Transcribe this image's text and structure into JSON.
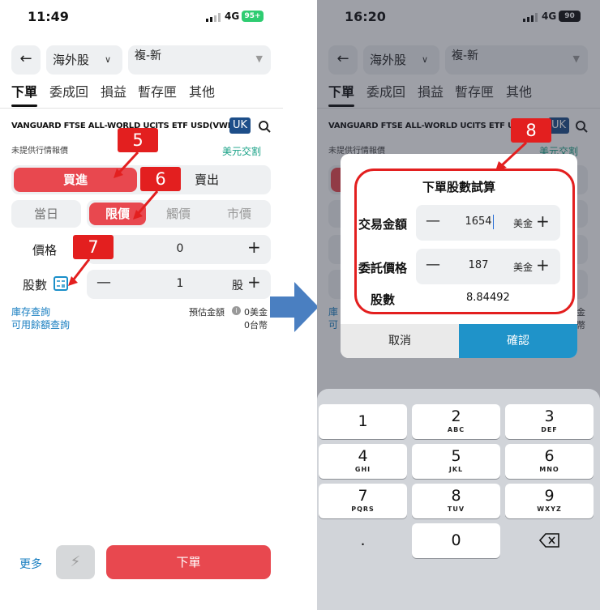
{
  "left": {
    "status": {
      "time": "11:49",
      "network": "4G",
      "battery": "95+"
    },
    "market_select": "海外股",
    "stock_select": "複-新",
    "tabs": [
      "下單",
      "委成回",
      "損益",
      "暫存匣",
      "其他"
    ],
    "stock_name": "VANGUARD FTSE ALL-WORLD UCITS ETF USD(VWRA)",
    "country_badge": "UK",
    "quote_note": "未提供行情報價",
    "settlement": "美元交割",
    "buy_label": "買進",
    "sell_label": "賣出",
    "day_label": "當日",
    "order_types": [
      "限價",
      "觸價",
      "市價"
    ],
    "price_label": "價格",
    "price_value": "0",
    "shares_label": "股數",
    "shares_value": "1",
    "shares_unit": "股",
    "inventory_link": "庫存查詢",
    "balance_link": "可用餘額查詢",
    "estimate_label": "預估金額",
    "estimate_usd": "0美金",
    "estimate_twd": "0台幣",
    "more_label": "更多",
    "order_button": "下單",
    "markers": [
      "5",
      "6",
      "7"
    ]
  },
  "right": {
    "status": {
      "time": "16:20",
      "network": "4G",
      "battery": "90"
    },
    "market_select": "海外股",
    "stock_select": "複-新",
    "tabs": [
      "下單",
      "委成回",
      "損益",
      "暫存匣",
      "其他"
    ],
    "stock_name": "VANGUARD FTSE ALL-WORLD UCITS ETF USD(VWRA)",
    "country_badge": "UK",
    "quote_note": "未提供行情報價",
    "settlement": "美元交割",
    "modal": {
      "title": "下單股數試算",
      "amount_label": "交易金額",
      "amount_value": "1654",
      "amount_unit": "美金",
      "price_label": "委託價格",
      "price_value": "187",
      "price_unit": "美金",
      "shares_label": "股數",
      "shares_value": "8.84492",
      "cancel": "取消",
      "confirm": "確認"
    },
    "marker": "8",
    "keypad": [
      {
        "digit": "1",
        "letters": ""
      },
      {
        "digit": "2",
        "letters": "ABC"
      },
      {
        "digit": "3",
        "letters": "DEF"
      },
      {
        "digit": "4",
        "letters": "GHI"
      },
      {
        "digit": "5",
        "letters": "JKL"
      },
      {
        "digit": "6",
        "letters": "MNO"
      },
      {
        "digit": "7",
        "letters": "PQRS"
      },
      {
        "digit": "8",
        "letters": "TUV"
      },
      {
        "digit": "9",
        "letters": "WXYZ"
      },
      {
        "digit": ".",
        "letters": ""
      },
      {
        "digit": "0",
        "letters": ""
      }
    ]
  },
  "colors": {
    "buy_red": "#e8484f",
    "accent_blue": "#1f93c9",
    "marker_red": "#e31f1f",
    "settle_green": "#16a085"
  }
}
